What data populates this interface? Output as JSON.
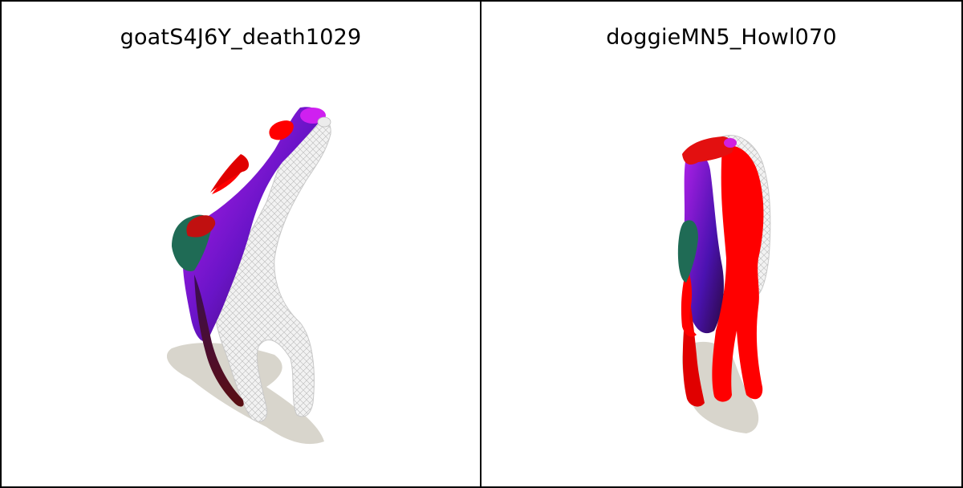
{
  "panels": [
    {
      "title": "goatS4J6Y_death1029",
      "subject": "goat-mesh"
    },
    {
      "title": "doggieMN5_Howl070",
      "subject": "dog-mesh"
    }
  ],
  "colors": {
    "background": "#ffffff",
    "border": "#000000",
    "shadow": "#d8d5cc",
    "wireframe": "#e6e6e6",
    "purple": "#8a1fd6",
    "red": "#ff0000",
    "teal": "#1f6b55"
  }
}
